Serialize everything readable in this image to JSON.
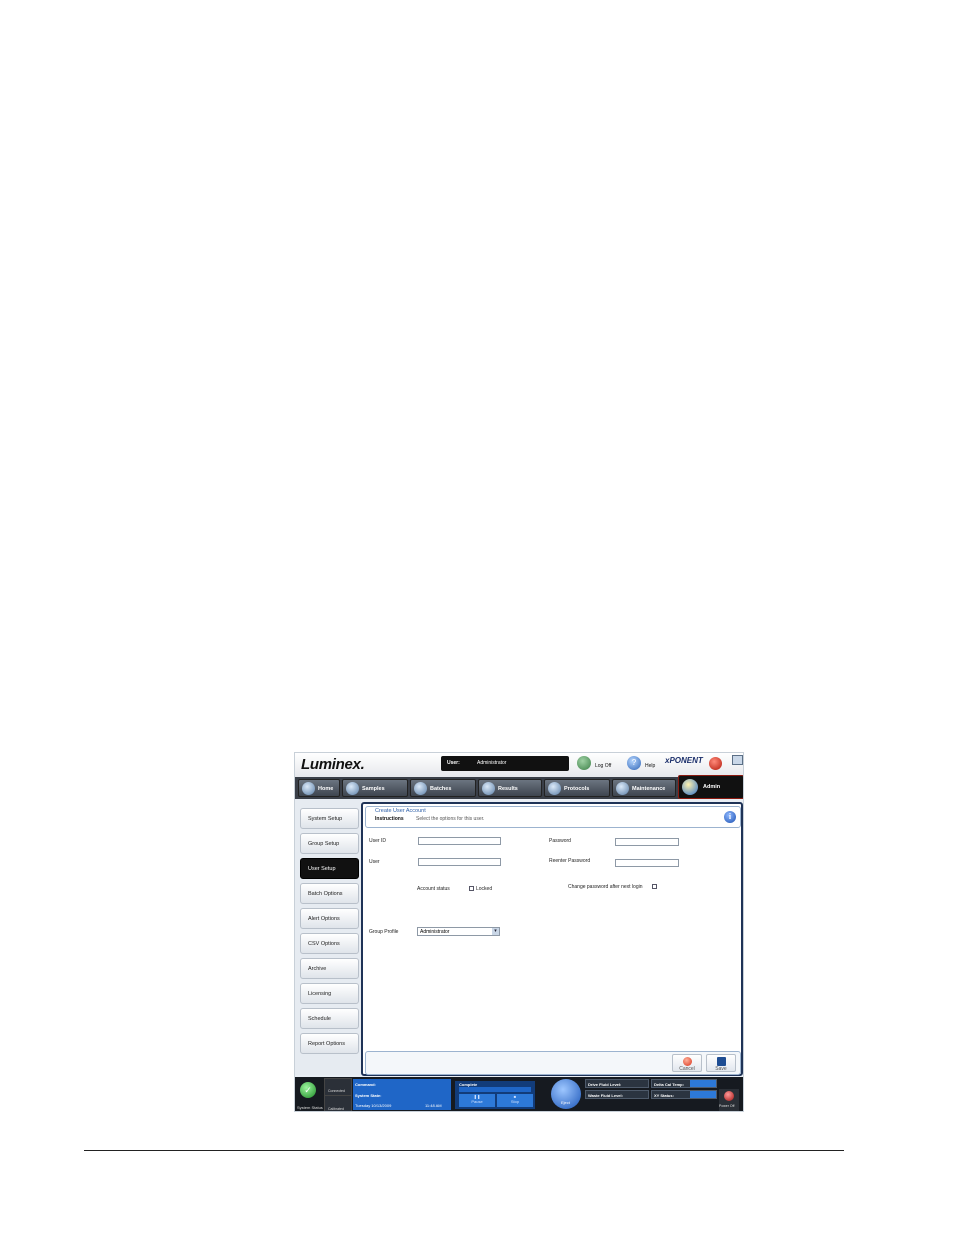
{
  "header": {
    "logo": "Luminex.",
    "user_label": "User:",
    "user_value": "Administrator",
    "logoff_label": "Log Off",
    "help_label": "Help",
    "brand": "xPONENT"
  },
  "tabs": [
    {
      "label": "Home",
      "icon": "home-icon"
    },
    {
      "label": "Samples",
      "icon": "samples-icon"
    },
    {
      "label": "Batches",
      "icon": "batches-icon"
    },
    {
      "label": "Results",
      "icon": "results-icon"
    },
    {
      "label": "Protocols",
      "icon": "protocols-icon"
    },
    {
      "label": "Maintenance",
      "icon": "maintenance-icon"
    },
    {
      "label": "Admin",
      "icon": "admin-icon",
      "active": true
    }
  ],
  "sidebar": {
    "items": [
      {
        "label": "System Setup"
      },
      {
        "label": "Group Setup"
      },
      {
        "label": "User Setup",
        "active": true
      },
      {
        "label": "Batch Options"
      },
      {
        "label": "Alert Options"
      },
      {
        "label": "CSV Options"
      },
      {
        "label": "Archive"
      },
      {
        "label": "Licensing"
      },
      {
        "label": "Schedule"
      },
      {
        "label": "Report Options"
      }
    ]
  },
  "form": {
    "title": "Create User Account",
    "instructions_label": "Instructions",
    "instructions_text": "Select the options for this user.",
    "user_id_label": "User ID",
    "user_id_value": "",
    "user_label": "User",
    "user_value": "",
    "password_label": "Password",
    "reenter_label": "Reenter Password",
    "account_status_label": "Account status",
    "locked_label": "Locked",
    "locked_checked": false,
    "change_pw_label": "Change password after next login",
    "change_pw_checked": false,
    "group_profile_label": "Group Profile",
    "group_profile_value": "Administrator",
    "cancel_label": "Cancel",
    "save_label": "Save"
  },
  "status_bar": {
    "system_status_label": "System Status",
    "connected_label": "Connected",
    "calibrated_label": "Calibrated",
    "command_label": "Command:",
    "system_state_label": "System State:",
    "date": "Tuesday 10/13/2009",
    "time": "11:48 AM",
    "complete_label": "Complete",
    "pause_label": "Pause",
    "stop_label": "Stop",
    "eject_label": "Eject",
    "drive_fluid_label": "Drive Fluid Level:",
    "waste_fluid_label": "Waste Fluid Level:",
    "delta_cal_label": "Delta Cal Temp:",
    "xy_status_label": "XY Status:",
    "power_off_label": "Power Off"
  },
  "colors": {
    "accent_blue": "#1f66c7",
    "dark": "#161a20",
    "panel_border": "#1f3357",
    "title_blue": "#2d5fa8",
    "active_border": "#8b1a10"
  }
}
